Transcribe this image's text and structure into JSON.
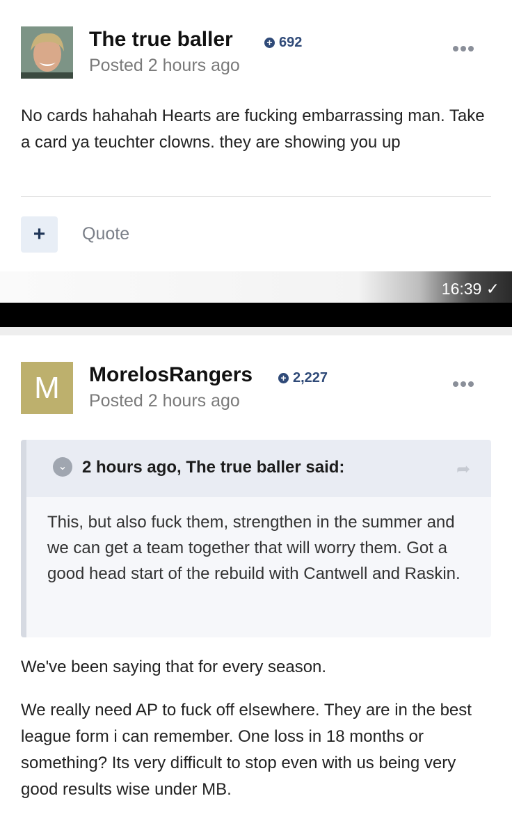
{
  "posts": [
    {
      "username": "The true baller",
      "reputation": "692",
      "posted": "Posted 2 hours ago",
      "avatar_type": "photo",
      "content": "No cards hahahah Hearts are fucking embarrassing man. Take a card ya teuchter clowns. they are showing you up",
      "quote_label": "Quote"
    },
    {
      "username": "MorelosRangers",
      "reputation": "2,227",
      "posted": "Posted 2 hours ago",
      "avatar_letter": "M",
      "quote": {
        "citation": "2 hours ago, The true baller said:",
        "text": "This, but also fuck them, strengthen in the summer and we can get a team together that will worry them. Got a good head start of the rebuild with Cantwell and Raskin."
      },
      "paragraphs": [
        "We've been saying that for every season.",
        "We really need AP to fuck off elsewhere. They are in the best league form i can remember. One loss in 18 months or something? Its very difficult to stop even with us being very good results wise under MB."
      ]
    }
  ],
  "message_time": "16:39 ✓",
  "colors": {
    "reputation": "#2f4a78",
    "avatar_letter_bg": "#bdb06d",
    "quote_header_bg": "#e9ecf3"
  },
  "icons": [
    "reputation-plus-icon",
    "more-options-icon",
    "plus-icon",
    "chevron-down-icon",
    "share-icon"
  ]
}
